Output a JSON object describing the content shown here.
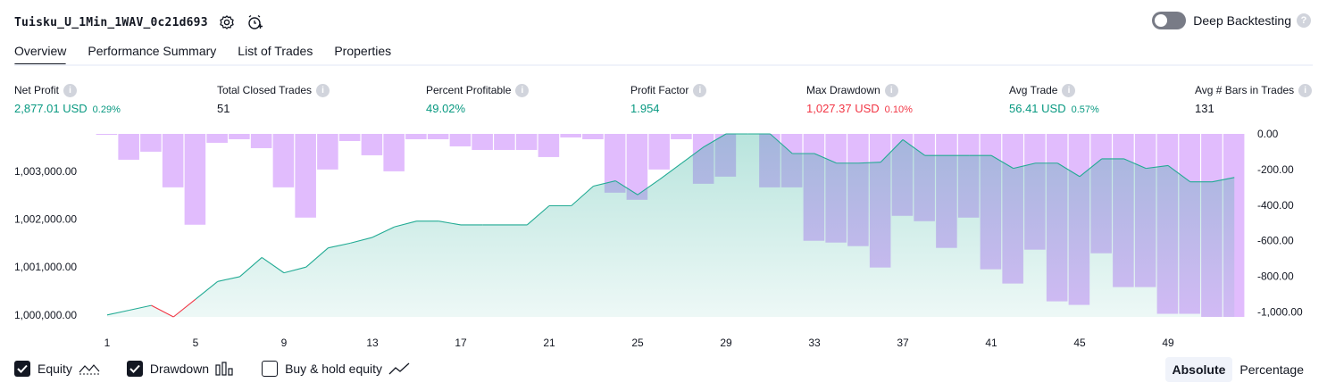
{
  "header": {
    "title": "Tuisku_U_1Min_1WAV_0c21d693",
    "deep_backtesting_label": "Deep Backtesting"
  },
  "tabs": [
    {
      "label": "Overview"
    },
    {
      "label": "Performance Summary"
    },
    {
      "label": "List of Trades"
    },
    {
      "label": "Properties"
    }
  ],
  "metrics": [
    {
      "label": "Net Profit",
      "value": "2,877.01 USD",
      "sub": "0.29%"
    },
    {
      "label": "Total Closed Trades",
      "value": "51",
      "sub": ""
    },
    {
      "label": "Percent Profitable",
      "value": "49.02%",
      "sub": ""
    },
    {
      "label": "Profit Factor",
      "value": "1.954",
      "sub": ""
    },
    {
      "label": "Max Drawdown",
      "value": "1,027.37 USD",
      "sub": "0.10%"
    },
    {
      "label": "Avg Trade",
      "value": "56.41 USD",
      "sub": "0.57%"
    },
    {
      "label": "Avg # Bars in Trades",
      "value": "131",
      "sub": ""
    }
  ],
  "colors": {
    "positive": "#089981",
    "negative": "#f23645",
    "equity_line": "#22ab94",
    "drawdown_bar": "#ce93fb",
    "text": "#131722"
  },
  "legend": {
    "equity_label": "Equity",
    "drawdown_label": "Drawdown",
    "buyhold_label": "Buy & hold equity",
    "equity_checked": true,
    "drawdown_checked": true,
    "buyhold_checked": false
  },
  "mode": {
    "absolute_label": "Absolute",
    "percentage_label": "Percentage",
    "selected": "absolute"
  },
  "chart_data": {
    "type": "area",
    "x_ticks": [
      "1",
      "5",
      "9",
      "13",
      "17",
      "21",
      "25",
      "29",
      "33",
      "37",
      "41",
      "45",
      "49"
    ],
    "left_axis": {
      "ticks": [
        "1,000,000.00",
        "1,001,000.00",
        "1,002,000.00",
        "1,003,000.00"
      ],
      "range": [
        999960,
        1003780
      ]
    },
    "right_axis": {
      "ticks": [
        "0.00",
        "-200.00",
        "-400.00",
        "-600.00",
        "-800.00",
        "-1,000.00"
      ],
      "range": [
        -1027.37,
        0
      ]
    },
    "series": [
      {
        "name": "Equity",
        "x": [
          1,
          2,
          3,
          4,
          5,
          6,
          7,
          8,
          9,
          10,
          11,
          12,
          13,
          14,
          15,
          16,
          17,
          18,
          19,
          20,
          21,
          22,
          23,
          24,
          25,
          26,
          27,
          28,
          29,
          30,
          31,
          32,
          33,
          34,
          35,
          36,
          37,
          38,
          39,
          40,
          41,
          42,
          43,
          44,
          45,
          46,
          47,
          48,
          49,
          50,
          51,
          52
        ],
        "values": [
          1000000,
          1000100,
          1000200,
          999960,
          1000330,
          1000700,
          1000800,
          1001200,
          1000880,
          1001000,
          1001400,
          1001500,
          1001620,
          1001840,
          1001960,
          1001960,
          1001880,
          1001880,
          1001880,
          1001880,
          1002280,
          1002280,
          1002690,
          1002800,
          1002510,
          1002830,
          1003170,
          1003510,
          1003780,
          1003780,
          1003780,
          1003370,
          1003370,
          1003170,
          1003170,
          1003190,
          1003660,
          1003330,
          1003330,
          1003330,
          1003330,
          1003060,
          1003170,
          1003170,
          1002890,
          1003260,
          1003260,
          1003060,
          1003120,
          1002780,
          1002780,
          1002870
        ]
      },
      {
        "name": "Drawdown",
        "x": [
          1,
          2,
          3,
          4,
          5,
          6,
          7,
          8,
          9,
          10,
          11,
          12,
          13,
          14,
          15,
          16,
          17,
          18,
          19,
          20,
          21,
          22,
          23,
          24,
          25,
          26,
          27,
          28,
          29,
          30,
          31,
          32,
          33,
          34,
          35,
          36,
          37,
          38,
          39,
          40,
          41,
          42,
          43,
          44,
          45,
          46,
          47,
          48,
          49,
          50,
          51,
          52
        ],
        "values": [
          -5,
          -145,
          -100,
          -300,
          -510,
          -50,
          -30,
          -80,
          -300,
          -470,
          -200,
          -40,
          -120,
          -210,
          -30,
          -30,
          -70,
          -90,
          -90,
          -90,
          -130,
          -20,
          -30,
          -330,
          -370,
          -200,
          -30,
          -280,
          -240,
          0,
          -300,
          -300,
          -600,
          -610,
          -630,
          -750,
          -460,
          -490,
          -640,
          -470,
          -760,
          -840,
          -650,
          -940,
          -960,
          -670,
          -860,
          -860,
          -1010,
          -1010,
          -1027.37,
          -1027.37
        ]
      }
    ],
    "xlim": [
      1,
      52
    ],
    "grid": false
  }
}
